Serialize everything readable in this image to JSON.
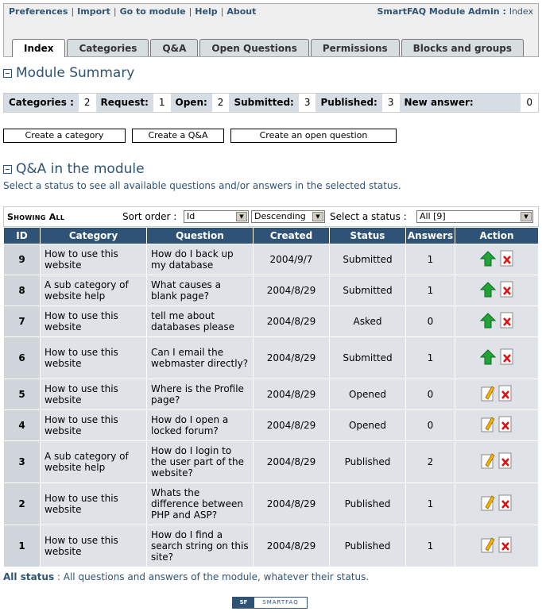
{
  "topmenu": [
    "Preferences",
    "Import",
    "Go to module",
    "Help",
    "About"
  ],
  "module_admin": {
    "label": "SmartFAQ Module Admin :",
    "current": "Index"
  },
  "tabs": [
    "Index",
    "Categories",
    "Q&A",
    "Open Questions",
    "Permissions",
    "Blocks and groups"
  ],
  "summary": {
    "title": "Module Summary",
    "items": [
      {
        "label": "Categories :",
        "value": "2"
      },
      {
        "label": "Request:",
        "value": "1"
      },
      {
        "label": "Open:",
        "value": "2"
      },
      {
        "label": "Submitted:",
        "value": "3"
      },
      {
        "label": "Published:",
        "value": "3"
      },
      {
        "label": "New answer:",
        "value": "0"
      }
    ]
  },
  "buttons": {
    "create_category": "Create a category",
    "create_qa": "Create a Q&A",
    "create_open": "Create an open question"
  },
  "qa_section": {
    "title": "Q&A in the module",
    "subtitle": "Select a status to see all available questions and/or answers in the selected status."
  },
  "filter": {
    "showing": "Showing All",
    "sort_label": "Sort order :",
    "sort_value": "Id",
    "order_value": "Descending",
    "status_label": "Select a status :",
    "status_value": "All [9]"
  },
  "table": {
    "headers": [
      "ID",
      "Category",
      "Question",
      "Created",
      "Status",
      "Answers",
      "Action"
    ],
    "rows": [
      {
        "id": "9",
        "category": "How to use this website",
        "question": "How do I back up my database",
        "created": "2004/9/7",
        "status": "Submitted",
        "answers": "1",
        "action": "approve-icon"
      },
      {
        "id": "8",
        "category": "A sub category of website help",
        "question": "What causes a blank page?",
        "created": "2004/8/29",
        "status": "Submitted",
        "answers": "1",
        "action": "approve-icon"
      },
      {
        "id": "7",
        "category": "How to use this website",
        "question": "tell me about databases please",
        "created": "2004/8/29",
        "status": "Asked",
        "answers": "0",
        "action": "approve-icon"
      },
      {
        "id": "6",
        "category": "How to use this website",
        "question": "Can I email the webmaster directly?",
        "created": "2004/8/29",
        "status": "Submitted",
        "answers": "1",
        "action": "approve-icon"
      },
      {
        "id": "5",
        "category": "How to use this website",
        "question": "Where is the Profile page?",
        "created": "2004/8/29",
        "status": "Opened",
        "answers": "0",
        "action": "edit-icon"
      },
      {
        "id": "4",
        "category": "How to use this website",
        "question": "How do I open a locked forum?",
        "created": "2004/8/29",
        "status": "Opened",
        "answers": "0",
        "action": "edit-icon"
      },
      {
        "id": "3",
        "category": "A sub category of website help",
        "question": "How do I login to the user part of the website?",
        "created": "2004/8/29",
        "status": "Published",
        "answers": "2",
        "action": "edit-icon"
      },
      {
        "id": "2",
        "category": "How to use this website",
        "question": "Whats the difference between PHP and ASP?",
        "created": "2004/8/29",
        "status": "Published",
        "answers": "1",
        "action": "edit-icon"
      },
      {
        "id": "1",
        "category": "How to use this website",
        "question": "How do I find a search string on this site?",
        "created": "2004/8/29",
        "status": "Published",
        "answers": "1",
        "action": "edit-icon"
      }
    ]
  },
  "footer": {
    "label": "All status",
    "text": " : All questions and answers of the module, whatever their status.",
    "logo_a": "SF",
    "logo_b": "SMARTFAQ"
  },
  "colors": {
    "header": "#2F5376",
    "cell": "#dfe3e7",
    "accent": "#2F5376"
  }
}
